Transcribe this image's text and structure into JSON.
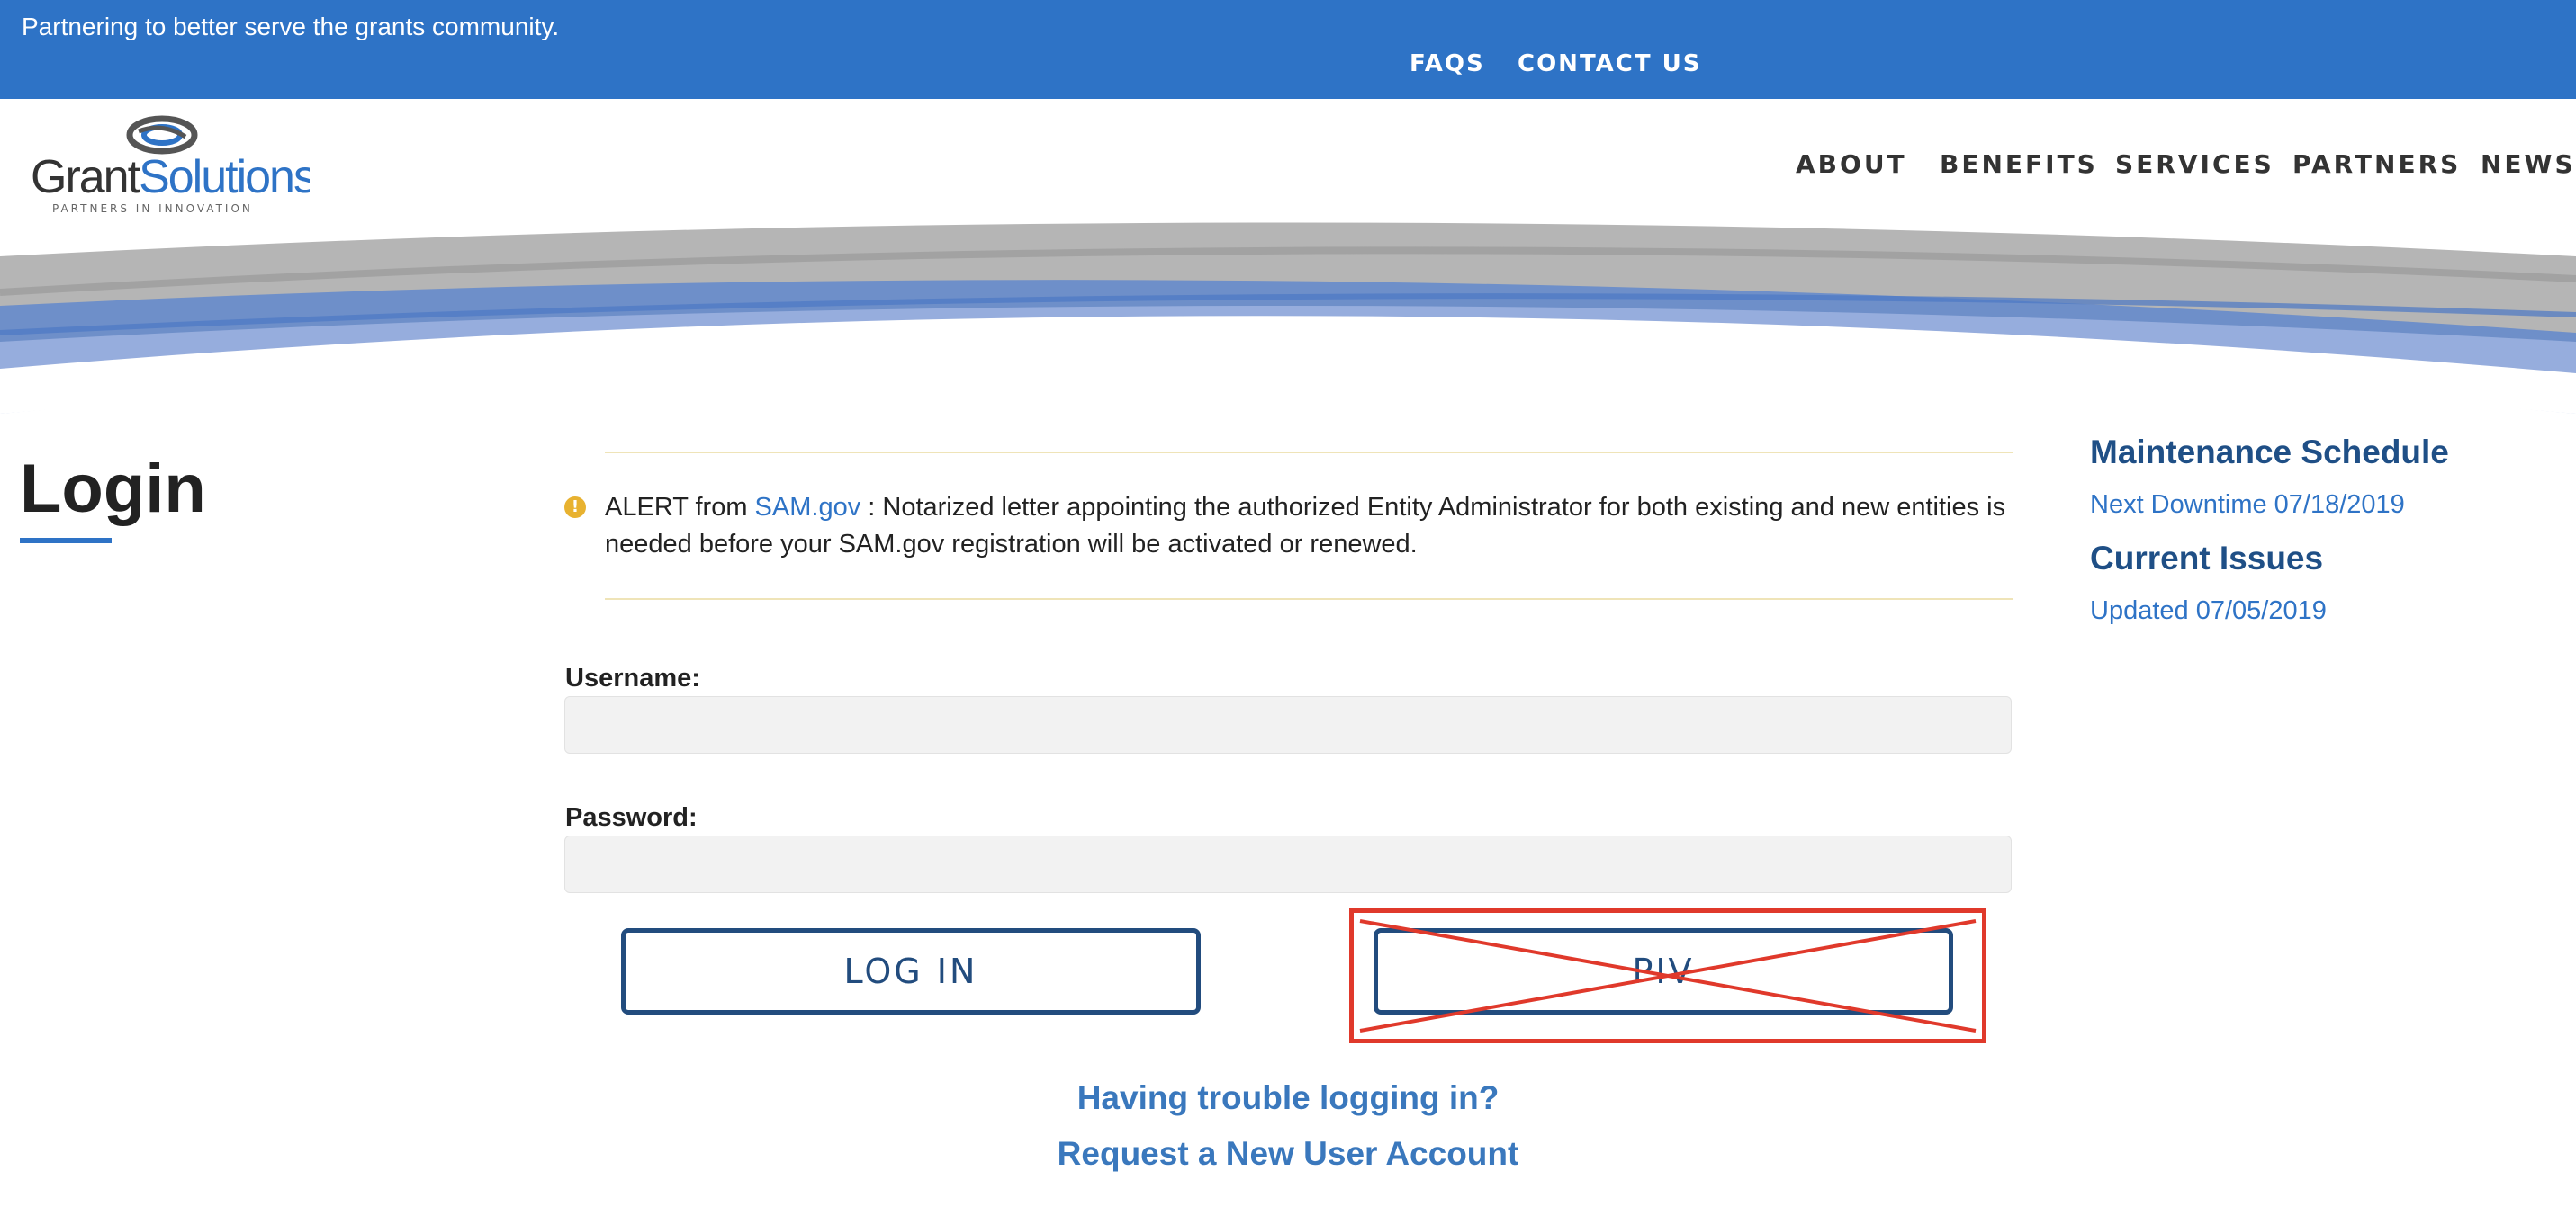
{
  "topbar": {
    "tagline": "Partnering to better serve the grants community.",
    "links": [
      "FAQS",
      "CONTACT US"
    ]
  },
  "brand": {
    "logo_text": "GrantSolutions",
    "logo_tagline": "PARTNERS IN INNOVATION"
  },
  "nav": {
    "items": [
      "ABOUT",
      "BENEFITS",
      "SERVICES",
      "PARTNERS",
      "NEWS"
    ]
  },
  "page": {
    "title": "Login"
  },
  "alert": {
    "prefix": "ALERT from ",
    "link": "SAM.gov",
    "message": " : Notarized letter appointing the authorized Entity Administrator for both existing and new entities is needed before your SAM.gov registration will be activated or renewed."
  },
  "form": {
    "username_label": "Username:",
    "username_value": "",
    "password_label": "Password:",
    "password_value": "",
    "login_button": "LOG IN",
    "piv_button": "PIV"
  },
  "help": {
    "trouble_link": "Having trouble logging in?",
    "request_link": "Request a New User Account"
  },
  "sidebar": {
    "maintenance_heading": "Maintenance Schedule",
    "maintenance_link": "Next Downtime 07/18/2019",
    "issues_heading": "Current Issues",
    "issues_link": "Updated 07/05/2019"
  },
  "colors": {
    "topbar": "#2e73c6",
    "button_border": "#224c7e",
    "heading_blue": "#1f4f86",
    "link_blue": "#2e73c6",
    "alert_icon": "#e8b230",
    "annotation_red": "#e0392b"
  }
}
